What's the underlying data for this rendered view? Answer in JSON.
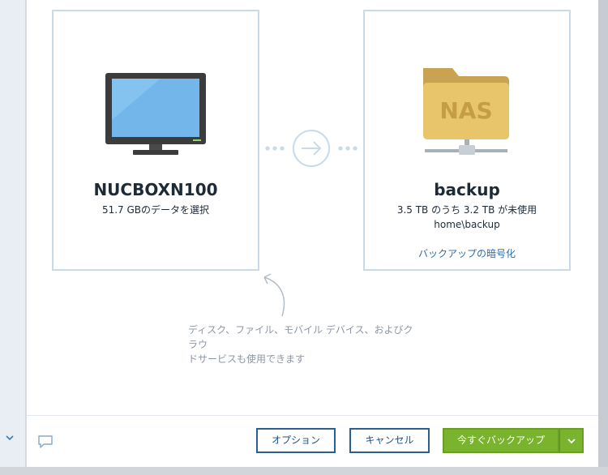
{
  "source": {
    "name": "NUCBOXN100",
    "selection": "51.7 GBのデータを選択"
  },
  "destination": {
    "name": "backup",
    "capacity": "3.5 TB のうち 3.2 TB が未使用",
    "path": "home\\backup",
    "encrypt_link": "バックアップの暗号化",
    "nas_label": "NAS"
  },
  "hint": {
    "line1": "ディスク、ファイル、モバイル デバイス、およびクラウ",
    "line2": "ドサービスも使用できます"
  },
  "footer": {
    "options_label": "オプション",
    "cancel_label": "キャンセル",
    "backup_now_label": "今すぐバックアップ"
  },
  "icons": {
    "source": "desktop-computer-icon",
    "destination": "nas-folder-icon",
    "connector": "arrow-right-circle-icon",
    "feedback": "chat-bubble-icon",
    "dropdown": "chevron-down-icon",
    "sidebar": "chevron-down-icon"
  },
  "colors": {
    "card_border": "#c9daea",
    "primary_button": "#7ab32e",
    "secondary_button_border": "#2c5f91",
    "link": "#2b6db0",
    "hint_text": "#8d97a2",
    "nas_folder": "#e8c46a"
  }
}
